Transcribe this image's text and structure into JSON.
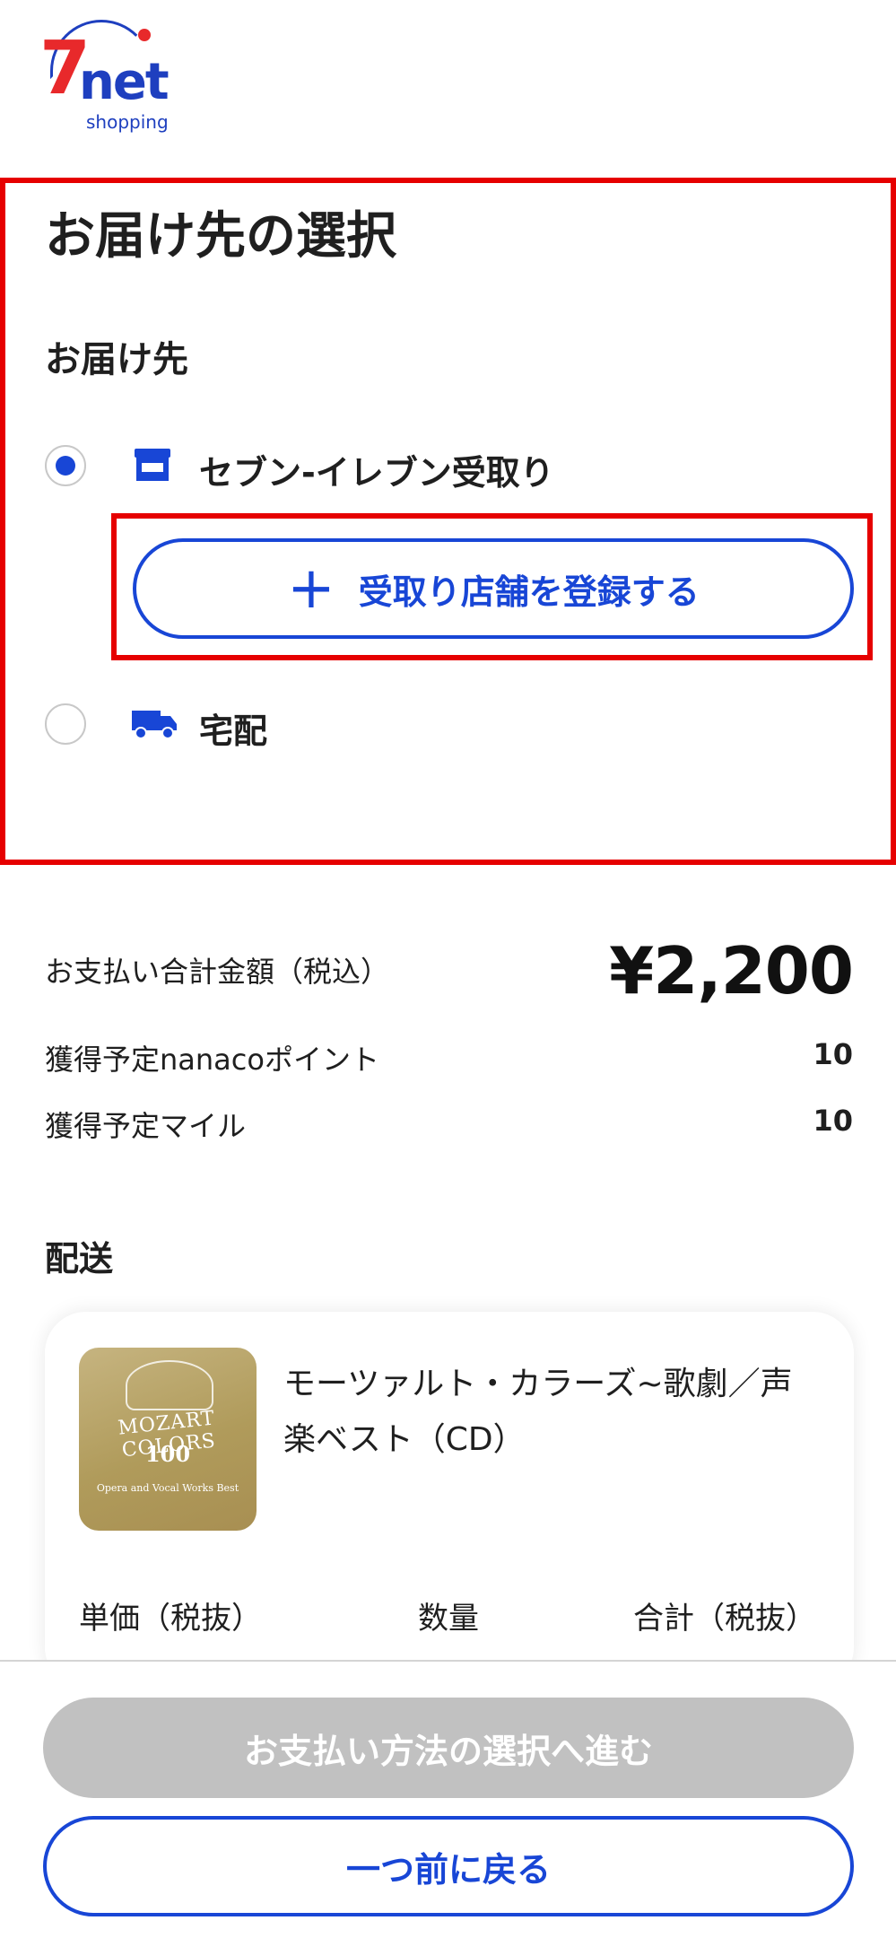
{
  "brand": {
    "seven": "7",
    "net": "net",
    "shopping": "shopping"
  },
  "header": {
    "title": "お届け先の選択"
  },
  "delivery": {
    "section_label": "お届け先",
    "options": [
      {
        "label": "セブン-イレブン受取り",
        "icon": "store-icon",
        "selected": true
      },
      {
        "label": "宅配",
        "icon": "truck-icon",
        "selected": false
      }
    ],
    "register_store_button": "受取り店舗を登録する",
    "register_plus": "+"
  },
  "summary": {
    "total_label": "お支払い合計金額（税込）",
    "total_value": "¥2,200",
    "points_label": "獲得予定nanacoポイント",
    "points_value": "10",
    "miles_label": "獲得予定マイル",
    "miles_value": "10"
  },
  "shipping": {
    "section_label": "配送",
    "product": {
      "title": "モーツァルト・カラーズ~歌劇／声楽ベスト（CD）",
      "cover_line1": "MOZART COLORS",
      "cover_line2": "100",
      "cover_line3": "Opera and Vocal Works Best"
    },
    "columns": [
      "単価（税抜）",
      "数量",
      "合計（税抜）"
    ]
  },
  "footer": {
    "proceed_button": "お支払い方法の選択へ進む",
    "back_button": "一つ前に戻る"
  },
  "colors": {
    "accent": "#1846d6",
    "highlight": "#e60000",
    "logo_red": "#e8292b",
    "disabled": "#c1c1c1"
  }
}
